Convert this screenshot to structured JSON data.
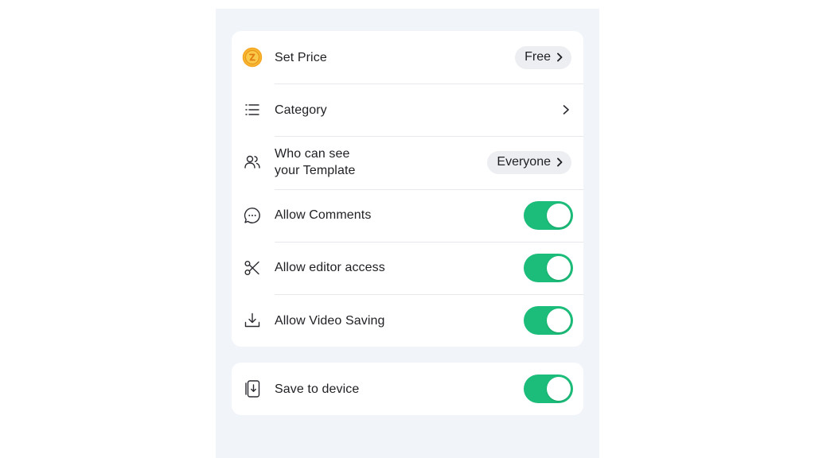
{
  "settings": {
    "items": [
      {
        "label": "Set Price",
        "control": "pill",
        "value": "Free",
        "icon": "coin-icon"
      },
      {
        "label": "Category",
        "control": "chevron",
        "icon": "list-icon"
      },
      {
        "label": "Who can see\nyour Template",
        "control": "pill",
        "value": "Everyone",
        "icon": "users-icon"
      },
      {
        "label": "Allow Comments",
        "control": "toggle",
        "on": true,
        "icon": "comment-icon"
      },
      {
        "label": "Allow editor access",
        "control": "toggle",
        "on": true,
        "icon": "scissors-icon"
      },
      {
        "label": "Allow Video Saving",
        "control": "toggle",
        "on": true,
        "icon": "download-icon"
      }
    ],
    "device": {
      "label": "Save to device",
      "control": "toggle",
      "on": true,
      "icon": "phone-download-icon"
    }
  },
  "colors": {
    "toggle_on": "#1cbd7a",
    "coin": "#f5a623",
    "background": "#f1f4f9",
    "card": "#ffffff"
  }
}
